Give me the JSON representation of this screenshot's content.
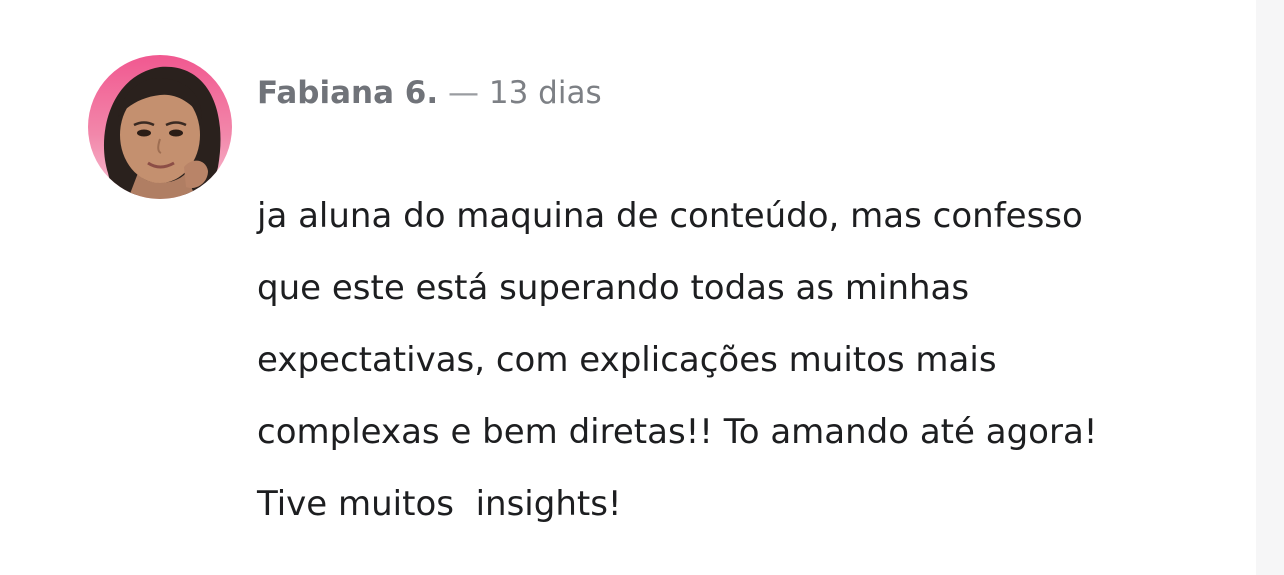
{
  "comment": {
    "author": "Fabiana 6.",
    "separator": " — ",
    "timestamp": "13 dias",
    "avatar": "avatar",
    "lines": [
      "ja aluna do maquina de conteúdo, mas confesso",
      "que este está superando todas as minhas",
      "expectativas, com explicações muitos mais",
      "complexas e bem diretas!! To amando até agora!",
      "Tive muitos  insights!"
    ]
  },
  "colors": {
    "author": "#707379",
    "timestamp": "#7d8085",
    "text": "#1d1e20",
    "avatar_background": "#ea6a96"
  }
}
